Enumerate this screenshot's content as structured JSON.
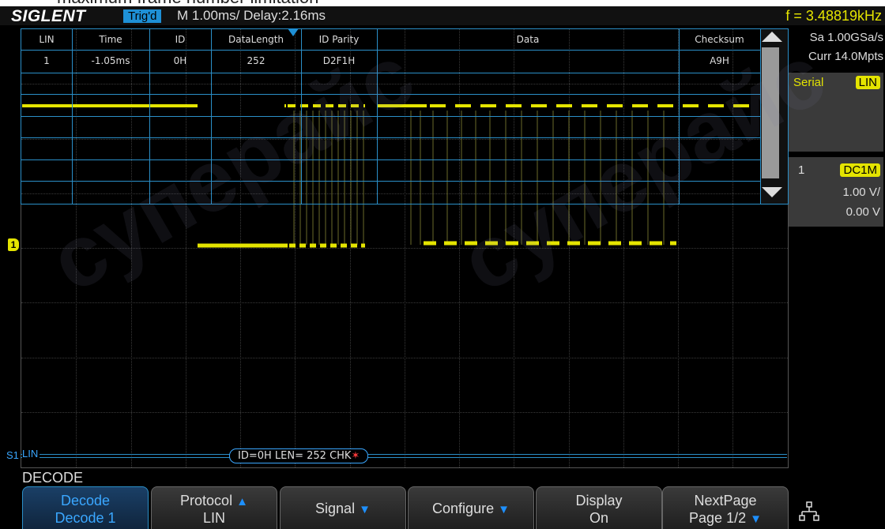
{
  "caption": "maximum frame number limitation",
  "header": {
    "brand": "SIGLENT",
    "trigger_status": "Trig'd",
    "timebase": "M 1.00ms/ Delay:2.16ms",
    "frequency": "f = 3.48819kHz"
  },
  "decode_table": {
    "columns": [
      "LIN",
      "Time",
      "ID",
      "DataLength",
      "ID Parity",
      "Data",
      "Checksum"
    ],
    "rows": [
      [
        "1",
        "-1.05ms",
        "0H",
        "252",
        "D2F1H",
        "",
        "A9H"
      ]
    ]
  },
  "right_panel": {
    "sample_rate": "Sa 1.00GSa/s",
    "memory_depth": "Curr 14.0Mpts",
    "serial_label": "Serial",
    "serial_protocol": "LIN",
    "channel_number": "1",
    "coupling": "DC1M",
    "volts_div": "1.00 V/",
    "offset": "0.00 V"
  },
  "bus": {
    "source_label": "S1",
    "name": "LIN",
    "frame_text": "ID=0H LEN= 252 CHK"
  },
  "channel_marker": "1",
  "menu": {
    "title": "DECODE",
    "softkeys": [
      {
        "line1": "Decode",
        "line2": "Decode 1"
      },
      {
        "line1": "Protocol",
        "line2": "LIN"
      },
      {
        "line1": "Signal",
        "line2": ""
      },
      {
        "line1": "Configure",
        "line2": ""
      },
      {
        "line1": "Display",
        "line2": "On"
      },
      {
        "line1": "NextPage",
        "line2": "Page 1/2"
      }
    ]
  },
  "watermark": "суперайс",
  "colors": {
    "trace": "#e4e400",
    "accent": "#1e90d6",
    "grid": "#2b8fc8"
  },
  "icons": {
    "lan": "network-icon",
    "scroll_up": "triangle-up-icon",
    "scroll_down": "triangle-down-icon"
  }
}
